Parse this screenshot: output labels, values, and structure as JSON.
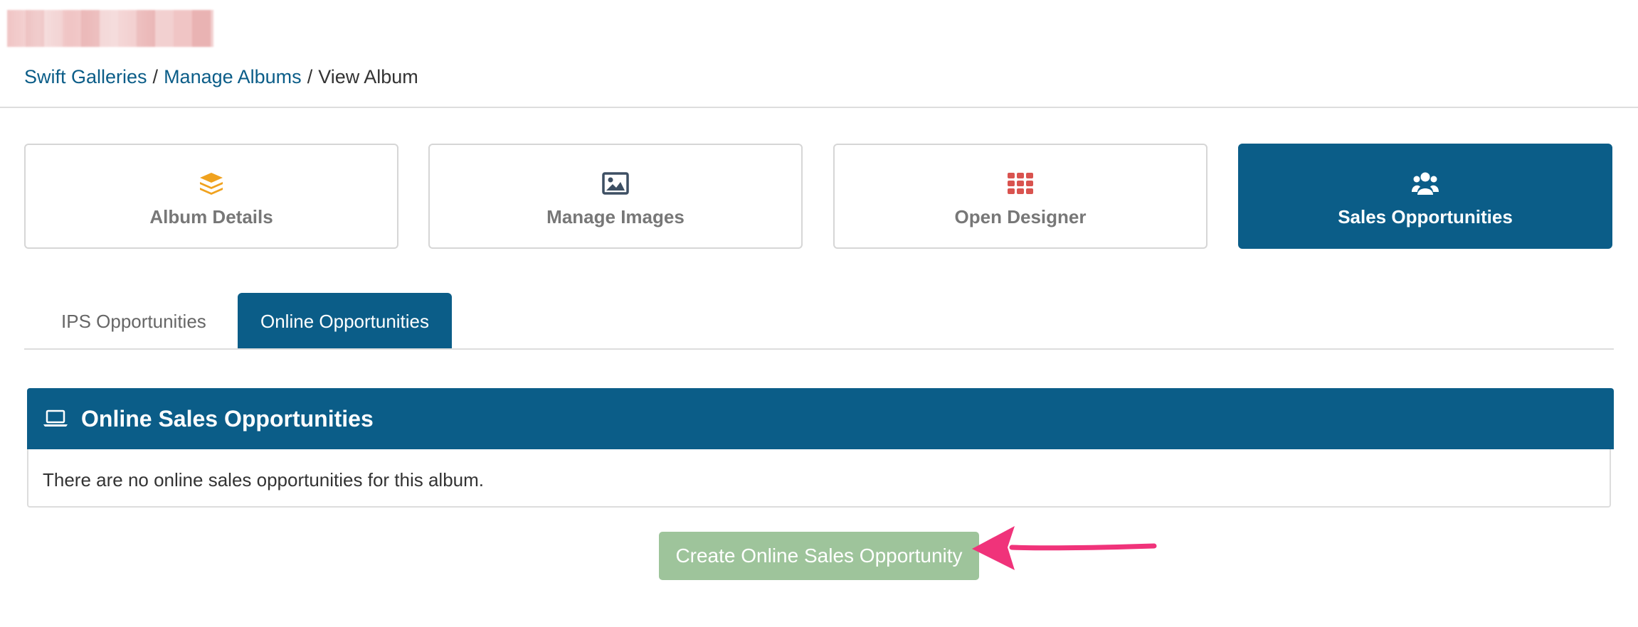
{
  "header": {
    "logo": "blurred-logo"
  },
  "breadcrumb": {
    "item1": "Swift Galleries",
    "item2": "Manage Albums",
    "current": "View Album",
    "separator": "/"
  },
  "tiles": {
    "album_details": "Album Details",
    "manage_images": "Manage Images",
    "open_designer": "Open Designer",
    "sales_opportunities": "Sales Opportunities"
  },
  "tabs": {
    "ips": "IPS Opportunities",
    "online": "Online Opportunities"
  },
  "panel": {
    "title": "Online Sales Opportunities",
    "empty_message": "There are no online sales opportunities for this album."
  },
  "actions": {
    "create_label": "Create Online Sales Opportunity"
  },
  "colors": {
    "brand": "#0b5d88",
    "success_disabled": "#9ec49b",
    "arrow": "#f0337a",
    "icon_album": "#f0a21f",
    "icon_designer": "#d9534f"
  },
  "icons": {
    "album_details": "layers-icon",
    "manage_images": "image-icon",
    "open_designer": "grid-icon",
    "sales_opportunities": "users-icon",
    "panel": "laptop-icon",
    "annotation": "arrow-annotation"
  }
}
